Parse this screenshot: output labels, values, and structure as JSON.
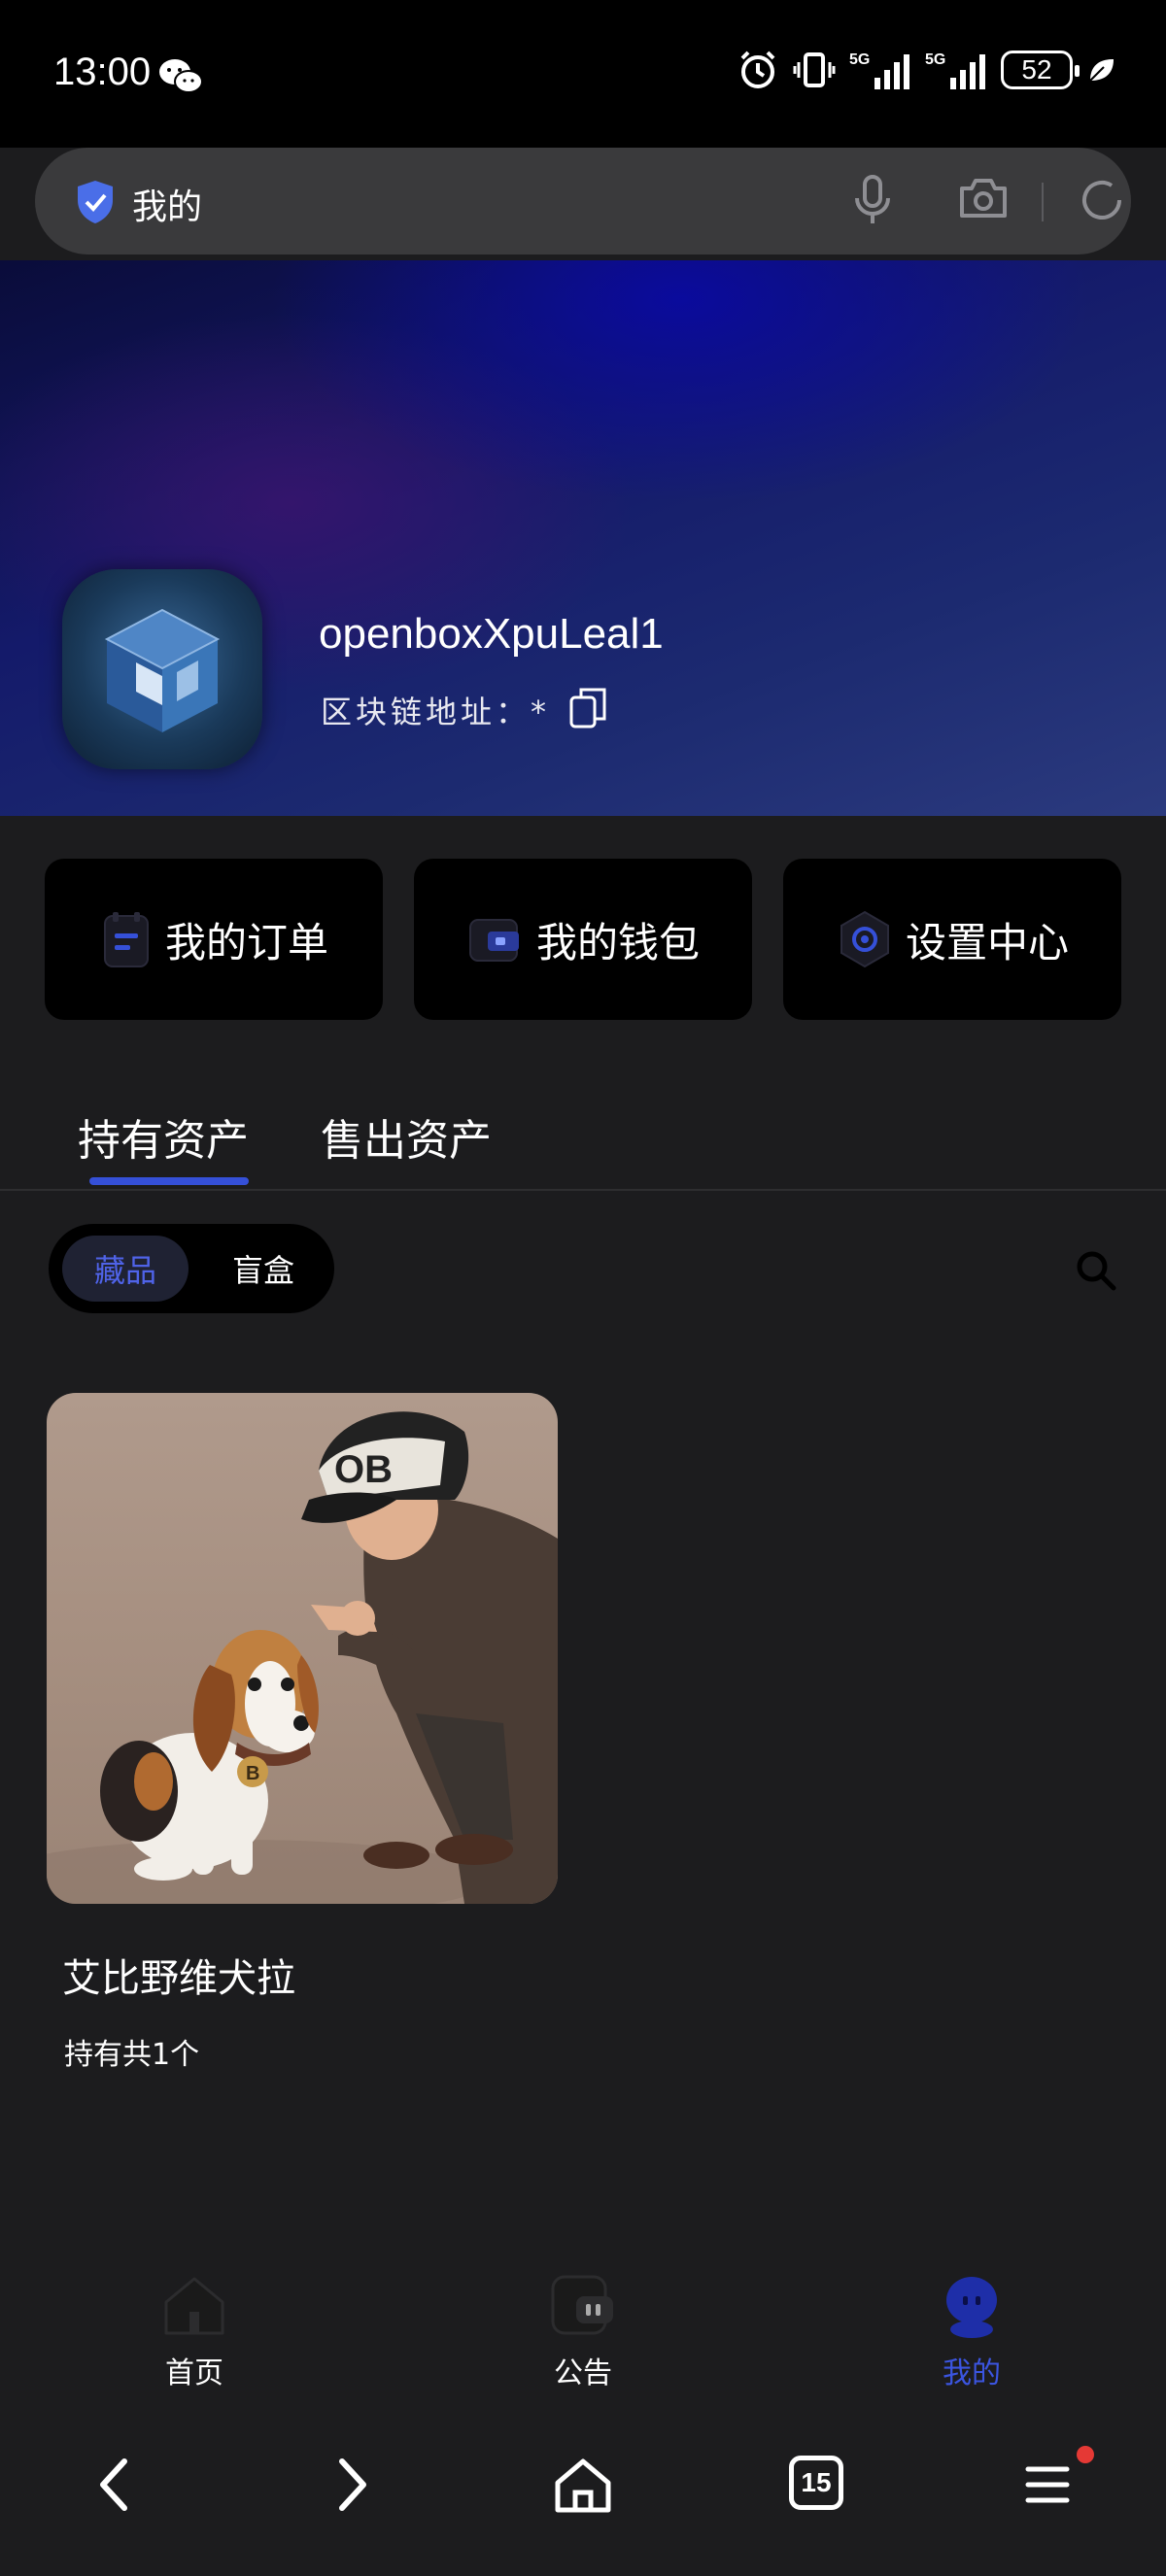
{
  "status_bar": {
    "time": "13:00",
    "signal_1": "5G",
    "signal_2": "5G",
    "battery": "52"
  },
  "search_bar": {
    "text": "我的"
  },
  "profile": {
    "username": "openboxXpuLeal1",
    "chain_address_label": "区块链地址：*"
  },
  "actions": [
    {
      "label": "我的订单"
    },
    {
      "label": "我的钱包"
    },
    {
      "label": "设置中心"
    }
  ],
  "tabs": [
    {
      "label": "持有资产",
      "active": true
    },
    {
      "label": "售出资产",
      "active": false
    }
  ],
  "segments": [
    {
      "label": "藏品",
      "active": true
    },
    {
      "label": "盲盒",
      "active": false
    }
  ],
  "items": [
    {
      "name": "艾比野维犬拉",
      "count_text": "持有共1个"
    }
  ],
  "app_nav": [
    {
      "label": "首页",
      "active": false
    },
    {
      "label": "公告",
      "active": false
    },
    {
      "label": "我的",
      "active": true
    }
  ],
  "browser_bar": {
    "tab_count": "15"
  },
  "colors": {
    "accent": "#3b55e0",
    "background": "#1c1c1e",
    "card": "#000000"
  }
}
